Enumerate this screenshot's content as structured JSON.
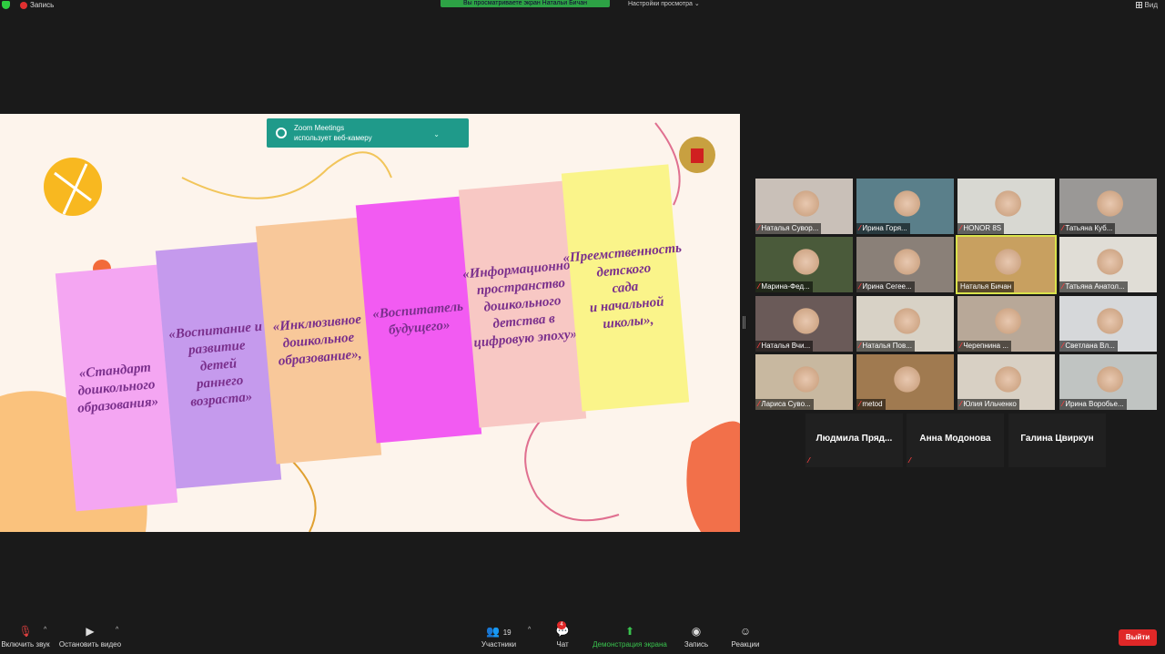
{
  "topbar": {
    "recording": "Запись",
    "share_banner": "Вы просматриваете экран Натальи Бичан",
    "view_options": "Настройки просмотра",
    "view": "Вид"
  },
  "notification": {
    "line1": "Zoom Meetings",
    "line2": "использует веб-камеру"
  },
  "slide": {
    "cards": [
      {
        "lines": [
          "«Стандарт",
          "дошкольного",
          "образования»"
        ],
        "color": "#f4a6f2"
      },
      {
        "lines": [
          "«Воспитание и",
          "развитие детей",
          "раннего",
          "возраста»"
        ],
        "color": "#c59aed"
      },
      {
        "lines": [
          "«Инклюзивное",
          "дошкольное",
          "образование»,"
        ],
        "color": "#f8c89a"
      },
      {
        "lines": [
          "«Воспитатель",
          "будущего»"
        ],
        "color": "#f25bf2"
      },
      {
        "lines": [
          "«Информационное",
          "пространство",
          "дошкольного",
          "детства в",
          "цифровую эпоху»"
        ],
        "color": "#f8c8c4"
      },
      {
        "lines": [
          "«Преемственность",
          "детского",
          "сада",
          "и начальной",
          "школы»,"
        ],
        "color": "#faf48a"
      }
    ]
  },
  "participants": [
    {
      "name": "Наталья Сувор...",
      "muted": true,
      "bg": "#c9c0b8"
    },
    {
      "name": "Ирина Горя...",
      "muted": true,
      "bg": "#5a7f8a"
    },
    {
      "name": "HONOR 8S",
      "muted": true,
      "bg": "#d8d8d2"
    },
    {
      "name": "Татьяна Куб...",
      "muted": true,
      "bg": "#9a9896"
    },
    {
      "name": "Марина-Фед...",
      "muted": true,
      "bg": "#4a5a3a"
    },
    {
      "name": "Ирина Сегее...",
      "muted": true,
      "bg": "#8a8078"
    },
    {
      "name": "Наталья Бичан",
      "muted": false,
      "bg": "#c8a060",
      "active": true
    },
    {
      "name": "Татьяна Анатол...",
      "muted": true,
      "bg": "#e0ddd6"
    },
    {
      "name": "Наталья Вчи...",
      "muted": true,
      "bg": "#6a5a58"
    },
    {
      "name": "Наталья Пов...",
      "muted": true,
      "bg": "#d8d2c6"
    },
    {
      "name": "Черепнина ...",
      "muted": true,
      "bg": "#b8a898"
    },
    {
      "name": "Светлана Вл...",
      "muted": true,
      "bg": "#d6d8da"
    },
    {
      "name": "Лариса Суво...",
      "muted": true,
      "bg": "#c8b8a0"
    },
    {
      "name": "metod",
      "muted": true,
      "bg": "#a07a50"
    },
    {
      "name": "Юлия Ильченко",
      "muted": true,
      "bg": "#d8d0c4"
    },
    {
      "name": "Ирина Воробье...",
      "muted": true,
      "bg": "#c0c4c2"
    }
  ],
  "audio_only": [
    {
      "name": "Людмила Пряд...",
      "muted": true
    },
    {
      "name": "Анна Модонова",
      "muted": true
    },
    {
      "name": "Галина Цвиркун",
      "muted": false
    }
  ],
  "toolbar": {
    "unmute": "Включить звук",
    "stop_video": "Остановить видео",
    "participants": "Участники",
    "participants_count": "19",
    "chat": "Чат",
    "chat_badge": "4",
    "share": "Демонстрация экрана",
    "record": "Запись",
    "reactions": "Реакции",
    "leave": "Выйти"
  },
  "colors": {
    "share_green": "#2da245",
    "leave_red": "#e02828",
    "active_speaker": "#d9e24a"
  }
}
